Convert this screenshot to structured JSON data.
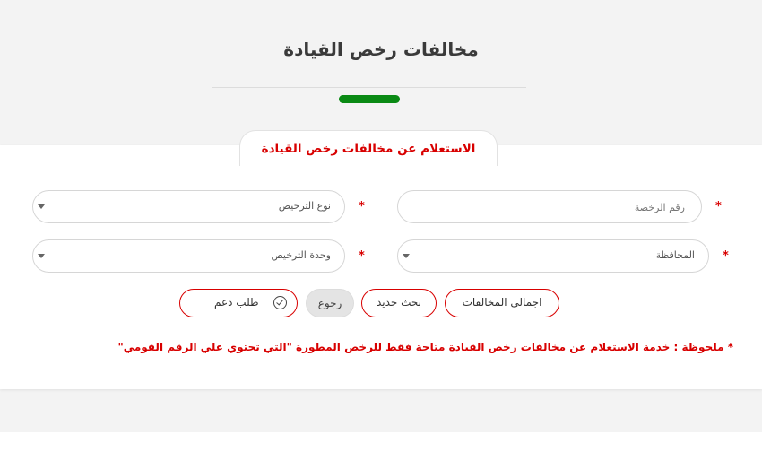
{
  "page": {
    "title": "مخالفات رخص القيادة",
    "accent_color": "#0a8a14"
  },
  "form": {
    "heading": "الاستعلام عن مخالفات رخص القيادة",
    "required_mark": "*",
    "license_number": {
      "placeholder": "رقم الرخصة",
      "value": ""
    },
    "license_type": {
      "selected": "نوع الترخيص"
    },
    "governorate": {
      "selected": "المحافظة"
    },
    "licensing_unit": {
      "selected": "وحدة الترخيص"
    }
  },
  "buttons": {
    "total_violations": "اجمالى المخالفات",
    "new_search": "بحث جديد",
    "back": "رجوع",
    "support": "طلب دعم"
  },
  "note": "* ملحوظة : خدمة الاستعلام عن مخالفات رخص القيادة متاحة فقط للرخص المطورة \"التي تحتوي علي الرقم القومي\"",
  "colors": {
    "primary_red": "#d80000",
    "green": "#0a8a14"
  }
}
